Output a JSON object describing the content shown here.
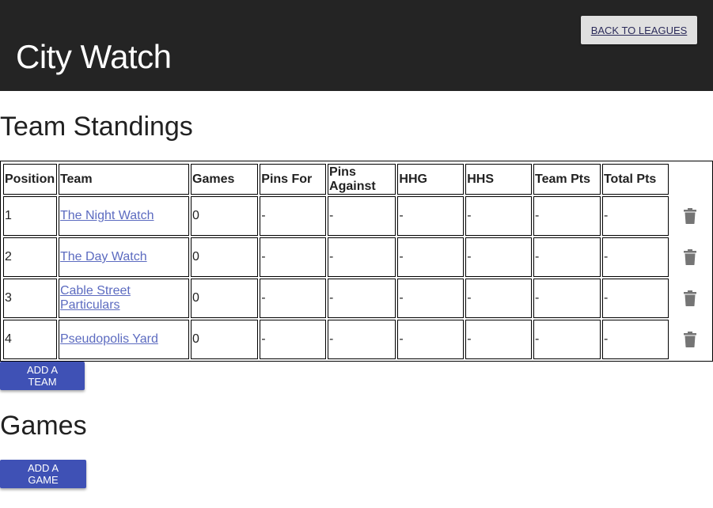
{
  "header": {
    "title": "City Watch",
    "back_label": "BACK TO LEAGUES"
  },
  "standings": {
    "title": "Team Standings",
    "columns": [
      "Position",
      "Team",
      "Games",
      "Pins For",
      "Pins Against",
      "HHG",
      "HHS",
      "Team Pts",
      "Total Pts"
    ],
    "rows": [
      {
        "position": "1",
        "team": "The Night Watch",
        "games": "0",
        "pins_for": "-",
        "pins_against": "-",
        "hhg": "-",
        "hhs": "-",
        "team_pts": "-",
        "total_pts": "-"
      },
      {
        "position": "2",
        "team": "The Day Watch",
        "games": "0",
        "pins_for": "-",
        "pins_against": "-",
        "hhg": "-",
        "hhs": "-",
        "team_pts": "-",
        "total_pts": "-"
      },
      {
        "position": "3",
        "team": "Cable Street Particulars",
        "games": "0",
        "pins_for": "-",
        "pins_against": "-",
        "hhg": "-",
        "hhs": "-",
        "team_pts": "-",
        "total_pts": "-"
      },
      {
        "position": "4",
        "team": "Pseudopolis Yard",
        "games": "0",
        "pins_for": "-",
        "pins_against": "-",
        "hhg": "-",
        "hhs": "-",
        "team_pts": "-",
        "total_pts": "-"
      }
    ],
    "row_action_icon": "trash-icon",
    "add_label": "ADD A TEAM"
  },
  "games": {
    "title": "Games",
    "add_label": "ADD A GAME"
  },
  "colors": {
    "header_bg": "#242424",
    "primary": "#3f51b5",
    "link": "#5c6bc0",
    "icon": "#757575"
  }
}
